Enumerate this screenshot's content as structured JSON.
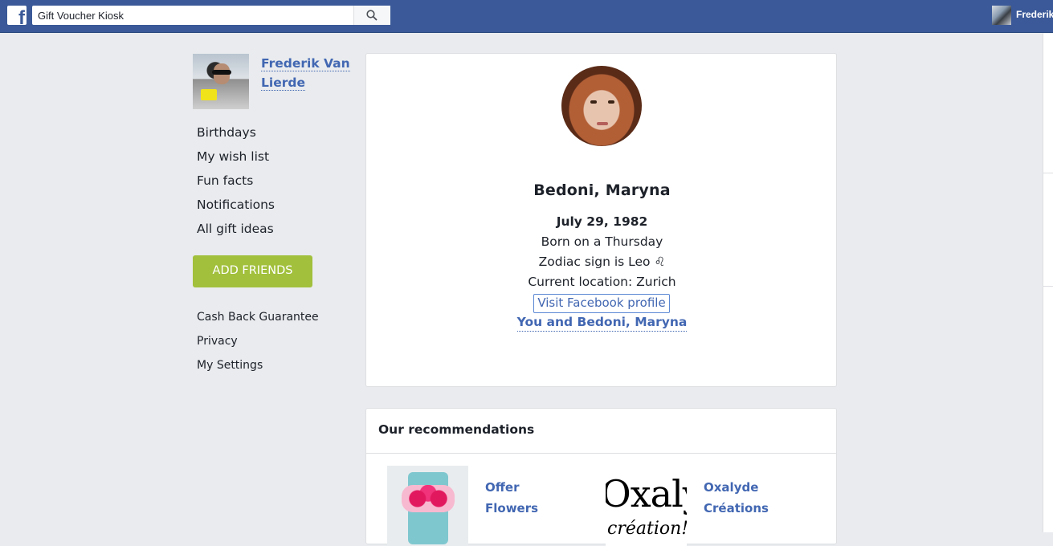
{
  "header": {
    "search_value": "Gift Voucher Kiosk",
    "user_short_name": "Frederik"
  },
  "sidebar": {
    "profile_name": "Frederik Van Lierde",
    "nav": [
      "Birthdays",
      "My wish list",
      "Fun facts",
      "Notifications",
      "All gift ideas"
    ],
    "add_friends_label": "ADD FRIENDS",
    "footer_links": [
      "Cash Back Guarantee",
      "Privacy",
      "My Settings"
    ]
  },
  "profile_card": {
    "name": "Bedoni, Maryna",
    "birthdate": "July 29, 1982",
    "born_on": "Born on a Thursday",
    "zodiac": "Zodiac sign is Leo ♌",
    "location": "Current location: Zurich",
    "facebook_link": "Visit Facebook profile",
    "relationship_link": "You and Bedoni, Maryna"
  },
  "recommendations": {
    "title": "Our recommendations",
    "items": [
      {
        "label": "Offer Flowers",
        "image_icon": "flower-box-image"
      },
      {
        "label": "Oxalyde Créations",
        "image_icon": "oxalyde-logo",
        "logo_text": "Oxalyde",
        "logo_subtext": "création!"
      }
    ]
  },
  "colors": {
    "topbar": "#3b5998",
    "link": "#4267b2",
    "add_button": "#a2c03c",
    "background": "#e9ebee"
  }
}
